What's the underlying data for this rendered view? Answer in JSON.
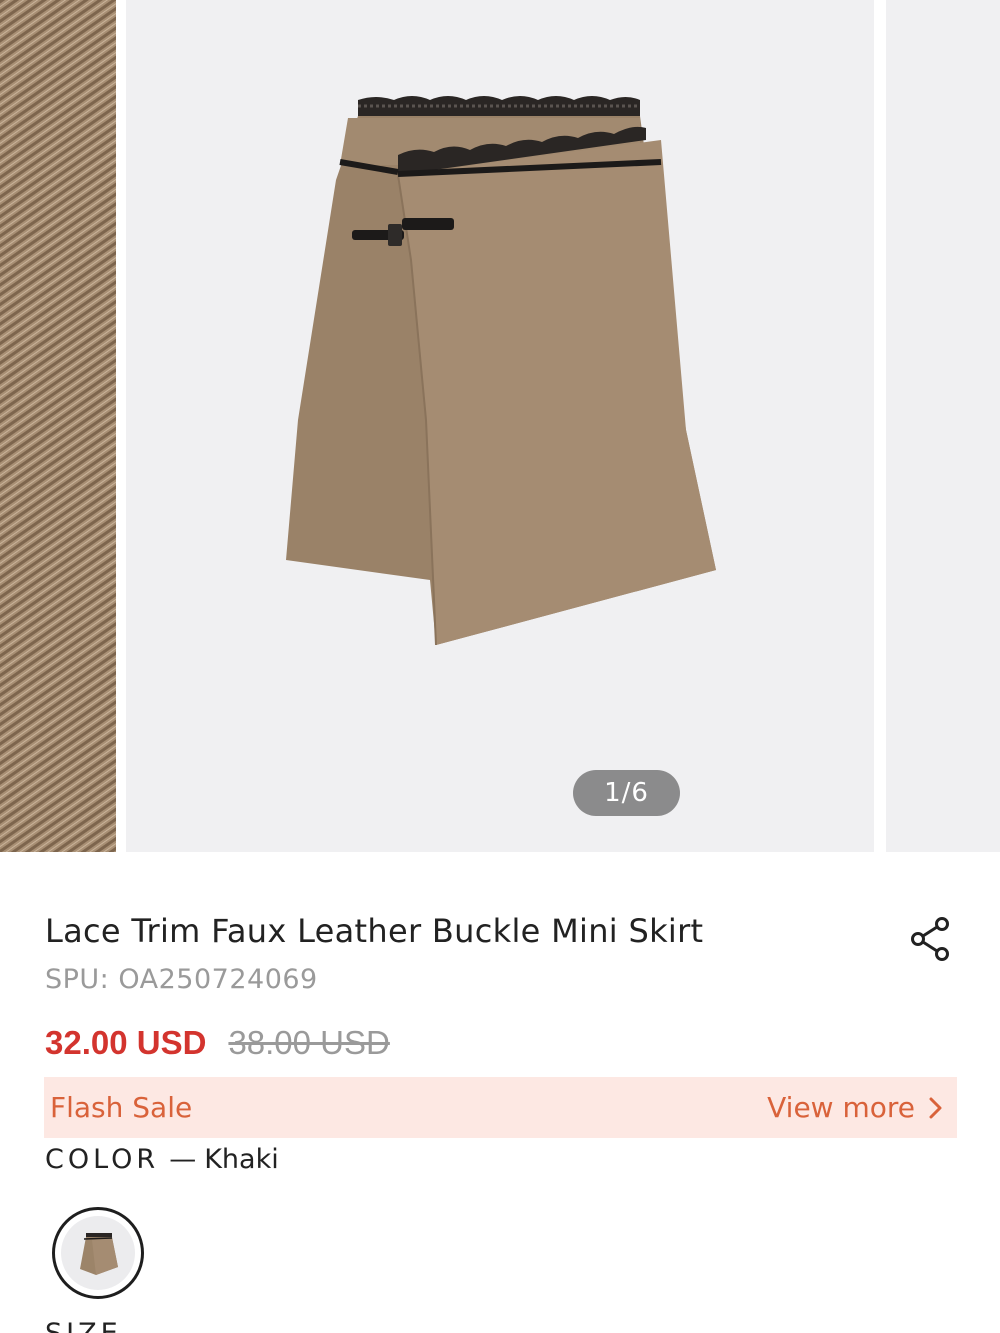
{
  "gallery": {
    "counter": "1/6"
  },
  "product": {
    "title": "Lace Trim Faux Leather Buckle Mini Skirt",
    "spu_label": "SPU: ",
    "spu_value": "OA250724069",
    "price_current": "32.00 USD",
    "price_original": "38.00 USD"
  },
  "promo": {
    "label": "Flash Sale",
    "link": "View more"
  },
  "color": {
    "label": "COLOR",
    "separator": "—",
    "value": "Khaki"
  },
  "size": {
    "label": "SIZE"
  },
  "icons": {
    "share": "share-icon",
    "chevron": "chevron-right-icon"
  },
  "colors": {
    "accent_red": "#d3342e",
    "flash_bg": "#fde8e3",
    "flash_text": "#d9623a",
    "khaki": "#9c8469"
  }
}
